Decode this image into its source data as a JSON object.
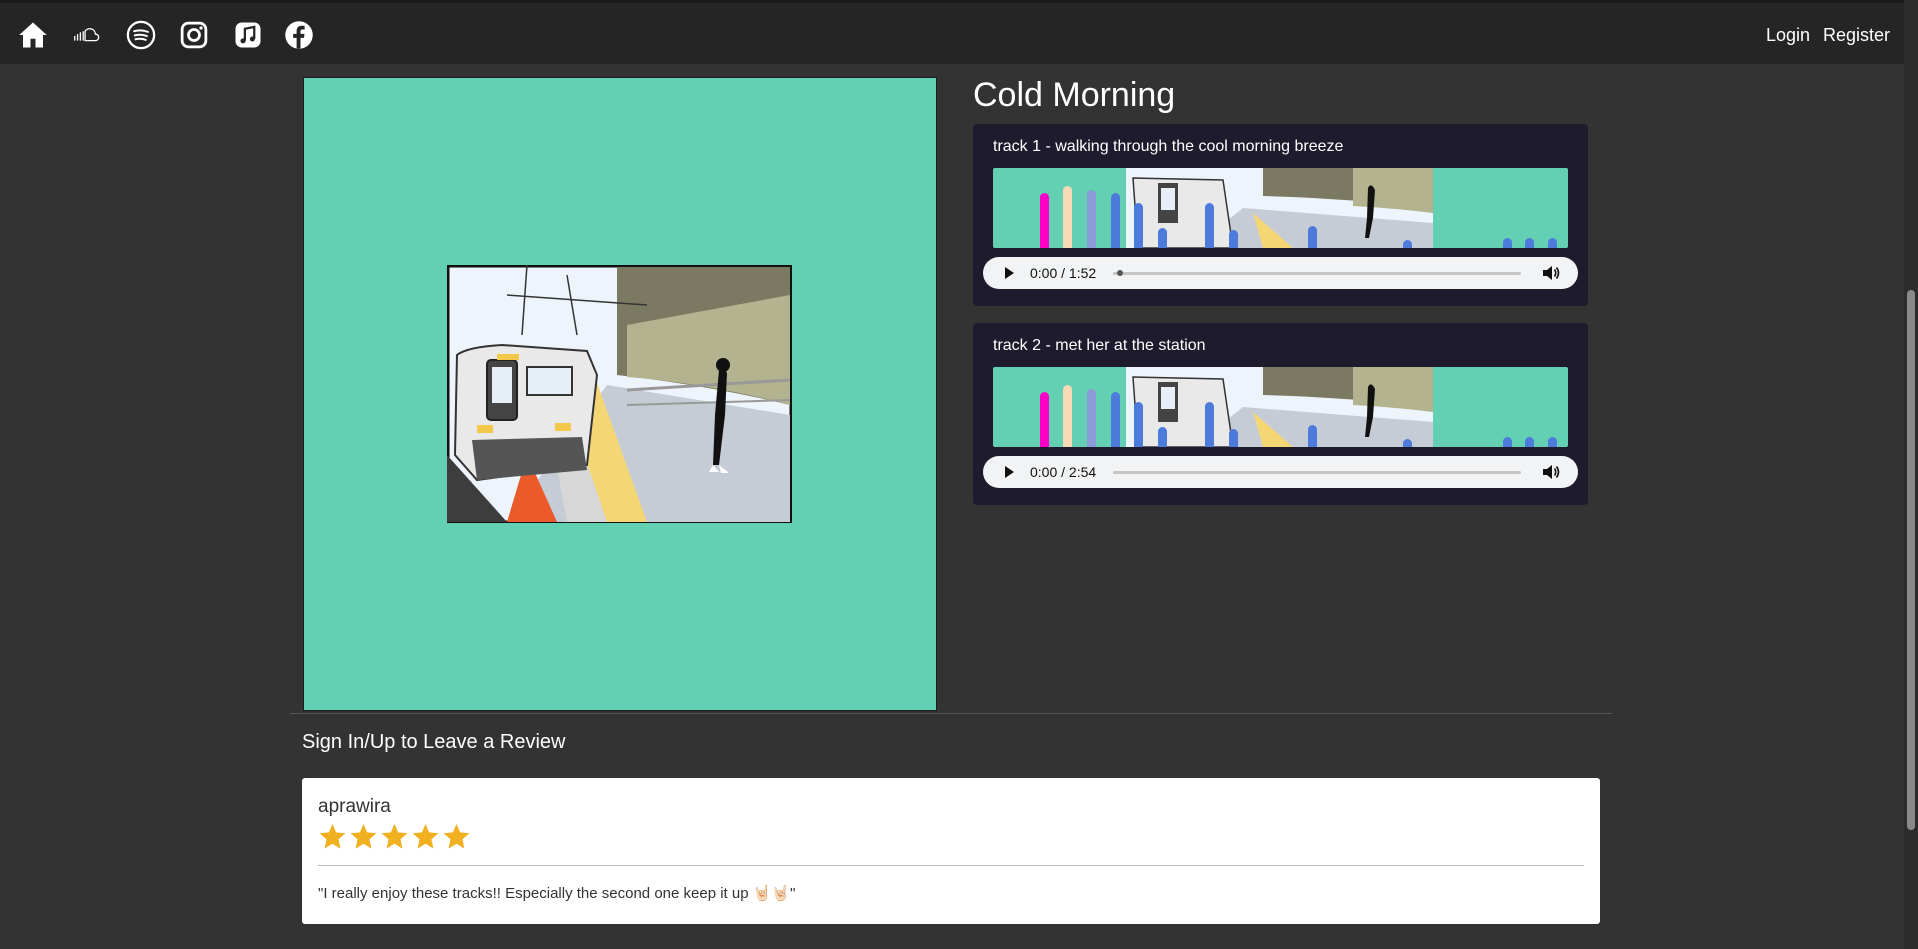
{
  "nav": {
    "icons": [
      "home-icon",
      "soundcloud-icon",
      "spotify-icon",
      "instagram-icon",
      "apple-music-icon",
      "facebook-icon"
    ],
    "login_label": "Login",
    "register_label": "Register"
  },
  "album": {
    "title": "Cold Morning",
    "background_color": "#63cfb3"
  },
  "tracks": [
    {
      "title": "track 1 - walking through the cool morning breeze",
      "current_time": "0:00",
      "duration": "1:52",
      "progress": 0.01
    },
    {
      "title": "track 2 - met her at the station",
      "current_time": "0:00",
      "duration": "2:54",
      "progress": 0
    }
  ],
  "reviews": {
    "prompt": "Sign In/Up to Leave a Review",
    "items": [
      {
        "author": "aprawira",
        "rating": 5,
        "comment": "\"I really enjoy these tracks!! Especially the second one keep it up 🤘🏻🤘🏻\""
      }
    ]
  },
  "colors": {
    "accent_teal": "#63cfb3",
    "star": "#f0b020",
    "track_bg": "#1f1b2e",
    "nav_bg": "#252525"
  }
}
